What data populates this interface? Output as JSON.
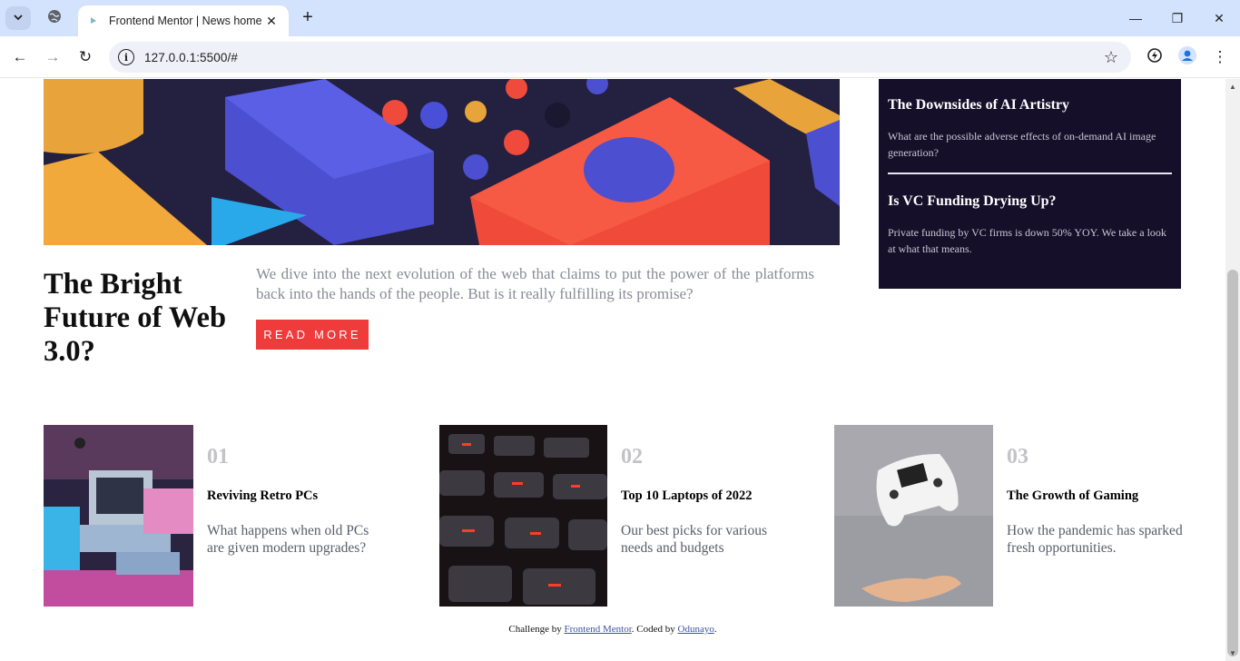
{
  "browser": {
    "tab_title": "Frontend Mentor | News homepage",
    "url": "127.0.0.1:5500/#",
    "new_tab_label": "+",
    "close_tab_glyph": "✕",
    "minimize_glyph": "—",
    "restore_glyph": "❐",
    "close_window_glyph": "✕",
    "back_glyph": "←",
    "forward_glyph": "→",
    "reload_glyph": "↻",
    "info_glyph": "i",
    "star_glyph": "☆",
    "menu_glyph": "⋮"
  },
  "colors": {
    "accent_red": "#ef3b3b",
    "dark_box": "#150f2a",
    "tabbar": "#d3e3fd"
  },
  "hero": {
    "headline": "The Bright Future of Web 3.0?",
    "lede": "We dive into the next evolution of the web that claims to put the power of the platforms back into the hands of the people. But is it really fulfilling its promise?",
    "read_more": "READ MORE"
  },
  "news": {
    "items": [
      {
        "title": "The Downsides of AI Artistry",
        "desc": "What are the possible adverse effects of on-demand AI image generation?"
      },
      {
        "title": "Is VC Funding Drying Up?",
        "desc": "Private funding by VC firms is down 50% YOY. We take a look at what that means."
      }
    ]
  },
  "cards": [
    {
      "num": "01",
      "title": "Reviving Retro PCs",
      "desc": "What happens when old PCs are given modern upgrades?"
    },
    {
      "num": "02",
      "title": "Top 10 Laptops of 2022",
      "desc": "Our best picks for various needs and budgets"
    },
    {
      "num": "03",
      "title": "The Growth of Gaming",
      "desc": "How the pandemic has sparked fresh opportunities."
    }
  ],
  "footer": {
    "prefix": "Challenge by ",
    "link1": "Frontend Mentor",
    "middle": ". Coded by ",
    "link2": "Odunayo",
    "suffix": "."
  }
}
